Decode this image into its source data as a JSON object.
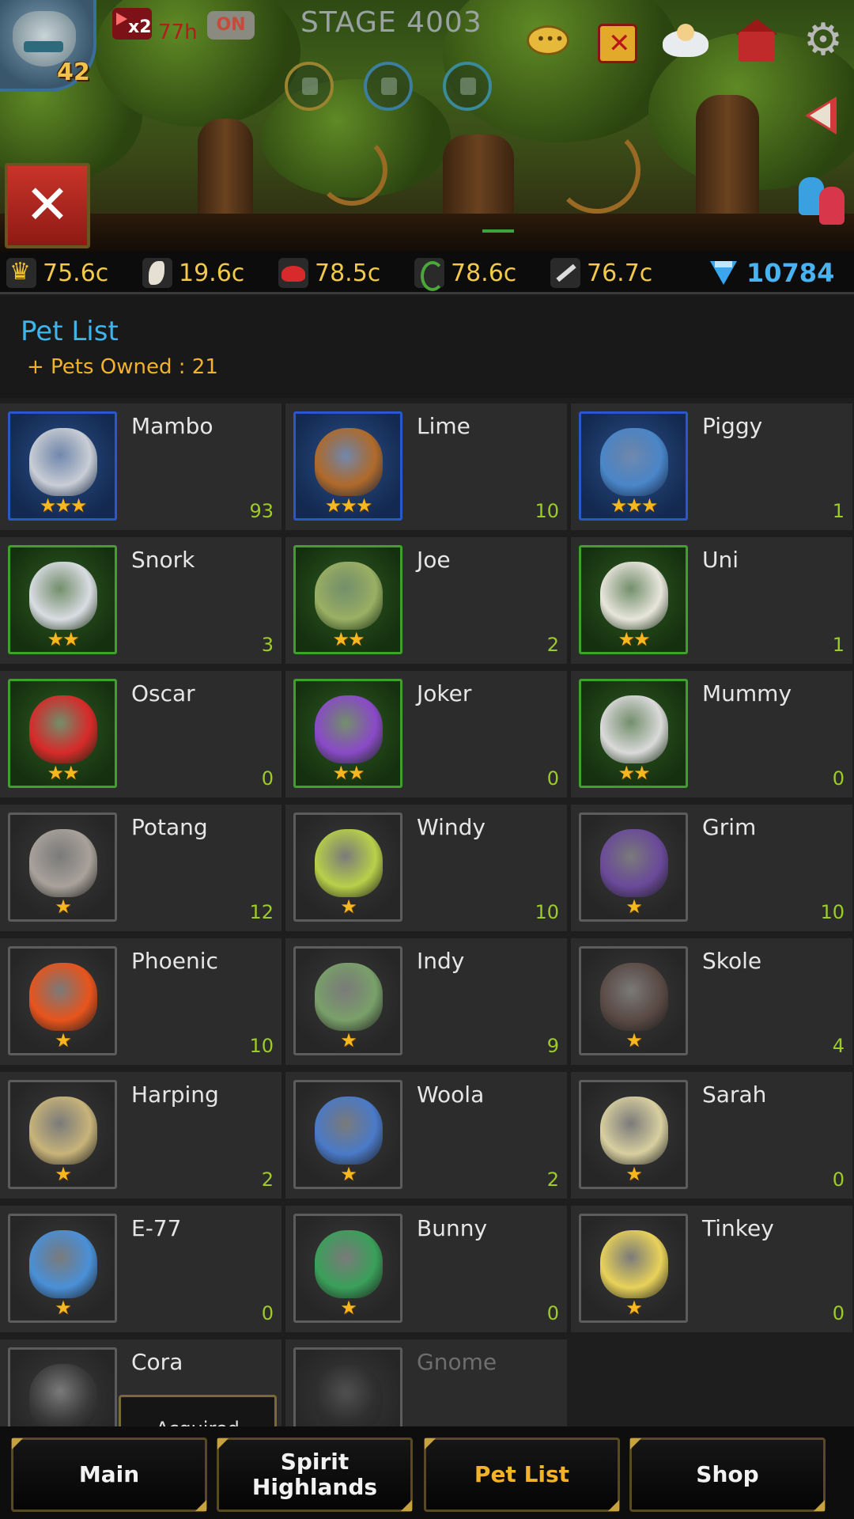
{
  "hud": {
    "level": "42",
    "speed_multiplier": "x2",
    "speed_timer": "77h",
    "auto_toggle": "ON",
    "stage": "STAGE 4003",
    "close_icon": "close-icon"
  },
  "resources": [
    {
      "icon": "crown-icon",
      "value": "75.6c"
    },
    {
      "icon": "feather-icon",
      "value": "19.6c"
    },
    {
      "icon": "meat-icon",
      "value": "78.5c"
    },
    {
      "icon": "vine-icon",
      "value": "78.6c"
    },
    {
      "icon": "sword-icon",
      "value": "76.7c"
    }
  ],
  "gems": {
    "icon": "diamond-icon",
    "value": "10784"
  },
  "panel": {
    "title": "Pet List",
    "owned_label": "+ Pets Owned : 21"
  },
  "pets": [
    {
      "name": "Mambo",
      "count": "93",
      "stars": "★★★",
      "rarity": "3",
      "color": "#c9ced6"
    },
    {
      "name": "Lime",
      "count": "10",
      "stars": "★★★",
      "rarity": "3",
      "color": "#b06a2a"
    },
    {
      "name": "Piggy",
      "count": "1",
      "stars": "★★★",
      "rarity": "3",
      "color": "#4a86c8"
    },
    {
      "name": "Snork",
      "count": "3",
      "stars": "★★",
      "rarity": "2",
      "color": "#d9dde2"
    },
    {
      "name": "Joe",
      "count": "2",
      "stars": "★★",
      "rarity": "2",
      "color": "#9ab064"
    },
    {
      "name": "Uni",
      "count": "1",
      "stars": "★★",
      "rarity": "2",
      "color": "#e8e6dc"
    },
    {
      "name": "Oscar",
      "count": "0",
      "stars": "★★",
      "rarity": "2",
      "color": "#d82a2a"
    },
    {
      "name": "Joker",
      "count": "0",
      "stars": "★★",
      "rarity": "2",
      "color": "#8a4ac8"
    },
    {
      "name": "Mummy",
      "count": "0",
      "stars": "★★",
      "rarity": "2",
      "color": "#dadada"
    },
    {
      "name": "Potang",
      "count": "12",
      "stars": "★",
      "rarity": "1",
      "color": "#a8a29a"
    },
    {
      "name": "Windy",
      "count": "10",
      "stars": "★",
      "rarity": "1",
      "color": "#b8d04a"
    },
    {
      "name": "Grim",
      "count": "10",
      "stars": "★",
      "rarity": "1",
      "color": "#6a4a9a"
    },
    {
      "name": "Phoenic",
      "count": "10",
      "stars": "★",
      "rarity": "1",
      "color": "#e8541c"
    },
    {
      "name": "Indy",
      "count": "9",
      "stars": "★",
      "rarity": "1",
      "color": "#7aa06a"
    },
    {
      "name": "Skole",
      "count": "4",
      "stars": "★",
      "rarity": "1",
      "color": "#5a4a44"
    },
    {
      "name": "Harping",
      "count": "2",
      "stars": "★",
      "rarity": "1",
      "color": "#c8b47a"
    },
    {
      "name": "Woola",
      "count": "2",
      "stars": "★",
      "rarity": "1",
      "color": "#4a7ac8"
    },
    {
      "name": "Sarah",
      "count": "0",
      "stars": "★",
      "rarity": "1",
      "color": "#d8cfa0"
    },
    {
      "name": "E-77",
      "count": "0",
      "stars": "★",
      "rarity": "1",
      "color": "#4a90d8"
    },
    {
      "name": "Bunny",
      "count": "0",
      "stars": "★",
      "rarity": "1",
      "color": "#3aa05a"
    },
    {
      "name": "Tinkey",
      "count": "0",
      "stars": "★",
      "rarity": "1",
      "color": "#e8d25a"
    },
    {
      "name": "Cora",
      "count": "",
      "stars": "",
      "rarity": "1",
      "color": "#3a3a3a",
      "locked": false,
      "button": "Acquired"
    },
    {
      "name": "Gnome",
      "count": "",
      "stars": "",
      "rarity": "1",
      "color": "#2c2c2c",
      "locked": true
    }
  ],
  "nav": {
    "main": "Main",
    "spirit": "Spirit\nHighlands",
    "petlist": "Pet List",
    "shop": "Shop"
  }
}
